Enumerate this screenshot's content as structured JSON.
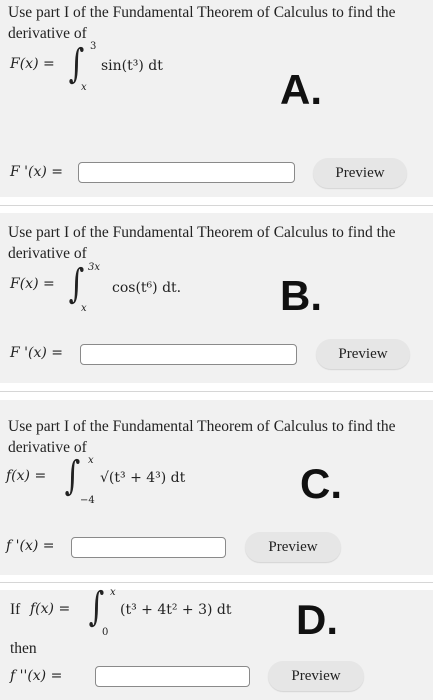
{
  "problems": [
    {
      "question": "Use part I of the Fundamental Theorem of Calculus to find the derivative of",
      "lhs": "F(x) =",
      "upper": "3",
      "lower": "x",
      "integrand": "sin(t³) dt",
      "answer_label": "F '(x) =",
      "answer_value": "",
      "preview": "Preview",
      "tag": "A."
    },
    {
      "question": "Use part I of the Fundamental Theorem of Calculus to find the derivative of",
      "lhs": "F(x) =",
      "upper": "3x",
      "lower": "x",
      "integrand": "cos(t⁶) dt.",
      "answer_label": "F '(x) =",
      "answer_value": "",
      "preview": "Preview",
      "tag": "B."
    },
    {
      "question": "Use part I of the Fundamental Theorem of Calculus to find the derivative of",
      "lhs": "f(x) =",
      "upper": "x",
      "lower": "−4",
      "integrand": "√(t³ + 4³) dt",
      "answer_label": "f '(x) =",
      "answer_value": "",
      "preview": "Preview",
      "tag": "C."
    },
    {
      "prefix": "If",
      "lhs": "f(x) =",
      "upper": "x",
      "lower": "0",
      "integrand": "(t³ + 4t² + 3) dt",
      "then": "then",
      "answer_label": "f ''(x) =",
      "answer_value": "",
      "preview": "Preview",
      "tag": "D."
    }
  ]
}
